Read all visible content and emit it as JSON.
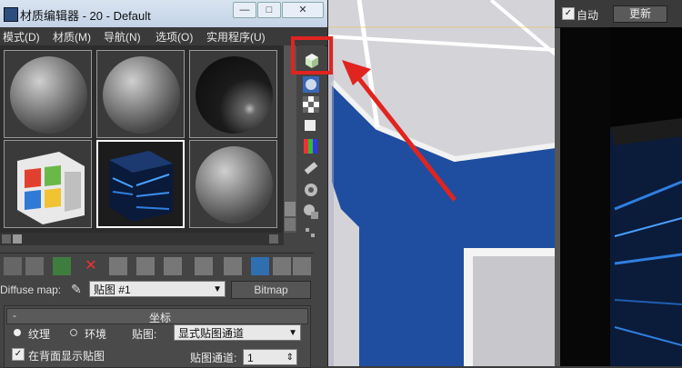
{
  "title": "材质编辑器 - 20 - Default",
  "window_controls": {
    "minimize": "—",
    "maximize": "□",
    "close": "✕"
  },
  "menu": [
    "模式(D)",
    "材质(M)",
    "导航(N)",
    "选项(O)",
    "实用程序(U)"
  ],
  "render_window": {
    "auto_label": "自动",
    "update_button": "更新",
    "auto_checked": true
  },
  "slots": [
    {
      "type": "sphere-gray"
    },
    {
      "type": "sphere-gray"
    },
    {
      "type": "sphere-dark"
    },
    {
      "type": "windows-cube"
    },
    {
      "type": "light-cube",
      "active": true
    },
    {
      "type": "sphere-gray"
    }
  ],
  "diffuse": {
    "label": "Diffuse map:",
    "map_name": "贴图 #1",
    "map_type": "Bitmap"
  },
  "coords": {
    "rollout_collapse": "-",
    "title": "坐标",
    "texture_label": "纹理",
    "environment_label": "环境",
    "map_label": "贴图:",
    "map_value": "显式贴图通道",
    "show_back_label": "在背面显示贴图",
    "channel_label": "贴图通道:",
    "channel_value": "1"
  },
  "icons": {
    "highlight_target": "sample-type-cube-icon",
    "annotation": "red-arrow"
  },
  "colors": {
    "highlight": "#e0241f",
    "viewport_blue": "#1f4ea0",
    "titlebar": "#c3d3e6"
  }
}
